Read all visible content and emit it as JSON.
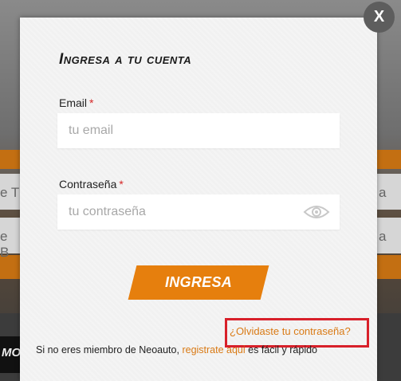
{
  "background": {
    "left_field_1": "e T",
    "left_field_2": "e B",
    "right_field_1": "a",
    "right_field_2": "a",
    "bottom_logo_fragment": "MO"
  },
  "modal": {
    "title": "Ingresa a tu cuenta",
    "close_label": "X",
    "email": {
      "label": "Email",
      "required_mark": "*",
      "placeholder": "tu email",
      "value": ""
    },
    "password": {
      "label": "Contraseña",
      "required_mark": "*",
      "placeholder": "tu contraseña",
      "value": "",
      "toggle_icon": "eye-icon"
    },
    "submit_label": "INGRESA",
    "forgot_password": "¿Olvidaste tu contraseña?",
    "register": {
      "prefix": "Si no eres miembro de Neoauto,",
      "link": "registrate aqui",
      "suffix": "es fácil y rápido"
    }
  },
  "colors": {
    "accent_orange": "#e67f0d",
    "link_orange": "#d97a15",
    "highlight_red": "#d8202a",
    "required_red": "#d52525"
  }
}
